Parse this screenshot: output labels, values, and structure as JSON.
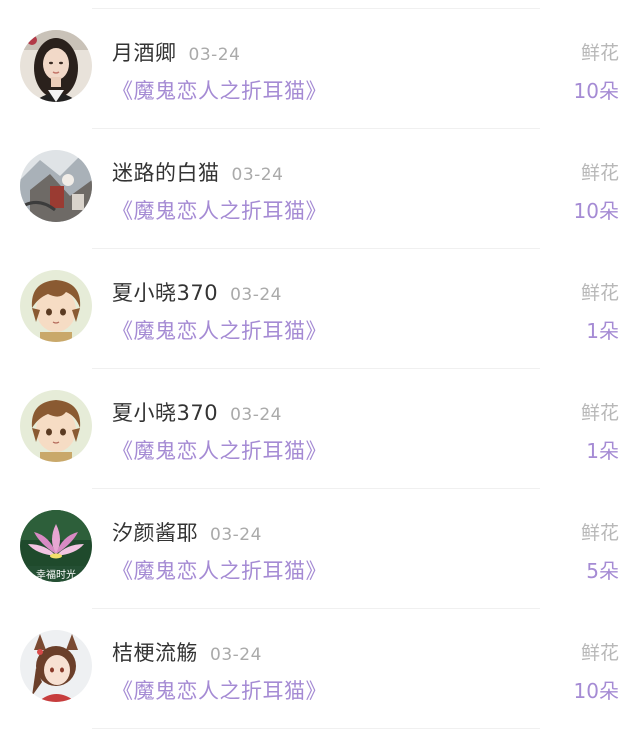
{
  "rows": [
    {
      "name": "月酒卿",
      "date": "03-24",
      "book": "《魔鬼恋人之折耳猫》",
      "gift": "鲜花",
      "qty": "10朵",
      "avatar": "woman-portrait"
    },
    {
      "name": "迷路的白猫",
      "date": "03-24",
      "book": "《魔鬼恋人之折耳猫》",
      "gift": "鲜花",
      "qty": "10朵",
      "avatar": "artwork"
    },
    {
      "name": "夏小晓370",
      "date": "03-24",
      "book": "《魔鬼恋人之折耳猫》",
      "gift": "鲜花",
      "qty": "1朵",
      "avatar": "anime-boy"
    },
    {
      "name": "夏小晓370",
      "date": "03-24",
      "book": "《魔鬼恋人之折耳猫》",
      "gift": "鲜花",
      "qty": "1朵",
      "avatar": "anime-boy"
    },
    {
      "name": "汐颜酱耶",
      "date": "03-24",
      "book": "《魔鬼恋人之折耳猫》",
      "gift": "鲜花",
      "qty": "5朵",
      "avatar": "lotus",
      "avatar_text": "幸福时光"
    },
    {
      "name": "桔梗流觞",
      "date": "03-24",
      "book": "《魔鬼恋人之折耳猫》",
      "gift": "鲜花",
      "qty": "10朵",
      "avatar": "anime-girl"
    }
  ],
  "colors": {
    "accent": "#a58bd4",
    "name": "#333333",
    "meta": "#aaaaaa",
    "gift": "#b8b8b8"
  }
}
